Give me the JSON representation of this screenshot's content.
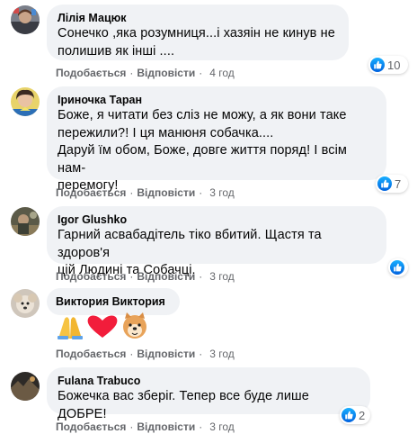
{
  "comments": [
    {
      "author": "Лілія Мацюк",
      "text": "Сонечко ,яка розумниця...і хазяін не кинув не\nполишив як інші ....",
      "like_label": "Подобається",
      "reply_label": "Відповісти",
      "time": "4 год",
      "reaction_count": "10"
    },
    {
      "author": "Іриночка Таран",
      "text": "Боже, я читати без сліз не можу, а як вони таке\nпережили?! І ця манюня собачка....\nДаруй їм обом, Боже, довге життя поряд! І всім нам-\nперемогу!",
      "like_label": "Подобається",
      "reply_label": "Відповісти",
      "time": "3 год",
      "reaction_count": "7"
    },
    {
      "author": "Igor Glushko",
      "text": "Гарний асвабадітель тіко вбитий. Щастя та здоров'я\nцій Людині та Собачці.",
      "like_label": "Подобається",
      "reply_label": "Відповісти",
      "time": "3 год",
      "reaction_count": ""
    },
    {
      "author": "Виктория Виктория",
      "emojis": [
        "🙏",
        "❤️",
        "🐶"
      ],
      "like_label": "Подобається",
      "reply_label": "Відповісти",
      "time": "3 год"
    },
    {
      "author": "Fulana Trabuco",
      "text": "Божечка вас зберіг. Тепер все буде лише ДОБРЕ!",
      "like_label": "Подобається",
      "reply_label": "Відповісти",
      "time": "3 год",
      "reaction_count": "2"
    }
  ],
  "colors": {
    "bubble": "#f0f2f5",
    "meta_text": "#65676b",
    "like_blue": "#1877f2"
  }
}
